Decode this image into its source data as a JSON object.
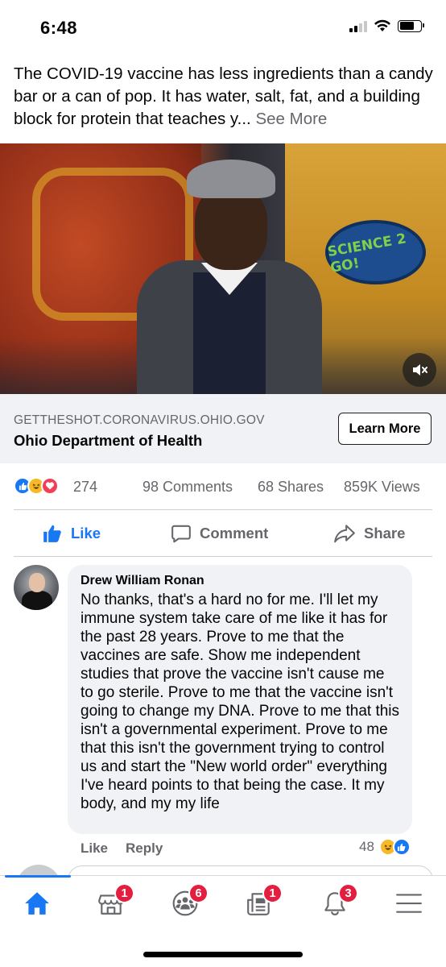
{
  "status_bar": {
    "time": "6:48",
    "icons": [
      "cellular-signal-icon",
      "wifi-icon",
      "battery-icon"
    ]
  },
  "post": {
    "text": "The COVID-19 vaccine has less ingredients than a candy bar or a can of pop. It has water, salt, fat, and a building block for protein that teaches y...",
    "see_more": "See More"
  },
  "video": {
    "sign_text": "SCIENCE 2 GO!",
    "mute_icon": "volume-muted-icon"
  },
  "link_preview": {
    "domain": "GETTHESHOT.CORONAVIRUS.OHIO.GOV",
    "title": "Ohio Department of Health",
    "cta": "Learn More"
  },
  "stats": {
    "reaction_icons": [
      "like-reaction-icon",
      "haha-reaction-icon",
      "love-reaction-icon"
    ],
    "reaction_count": "274",
    "comments": "98 Comments",
    "shares": "68 Shares",
    "views": "859K Views"
  },
  "actions": {
    "like": "Like",
    "comment": "Comment",
    "share": "Share"
  },
  "comment": {
    "author": "Drew William Ronan",
    "text": "No thanks, that's a hard no for me. I'll let my immune system take care of me like it has for the past 28 years. Prove to me that the vaccines are safe. Show me independent studies that prove the vaccine isn't cause me to go sterile. Prove to me that  the vaccine isn't going to change my DNA.  Prove to me that this isn't a governmental experiment. Prove to me that this isn't the government trying to control us and start the \"New world order\" everything I've heard points to that being the case. It my body, and my my life",
    "like": "Like",
    "reply": "Reply",
    "reaction_count": "48"
  },
  "tab_bar": {
    "tabs": [
      {
        "icon": "home-icon",
        "badge": ""
      },
      {
        "icon": "marketplace-icon",
        "badge": "1"
      },
      {
        "icon": "groups-icon",
        "badge": "6"
      },
      {
        "icon": "news-icon",
        "badge": "1"
      },
      {
        "icon": "bell-icon",
        "badge": "3"
      },
      {
        "icon": "menu-icon",
        "badge": ""
      }
    ]
  },
  "colors": {
    "accent": "#1877f2",
    "badge": "#e41e3f",
    "secondary_text": "#65676b",
    "bubble": "#f0f2f5"
  }
}
